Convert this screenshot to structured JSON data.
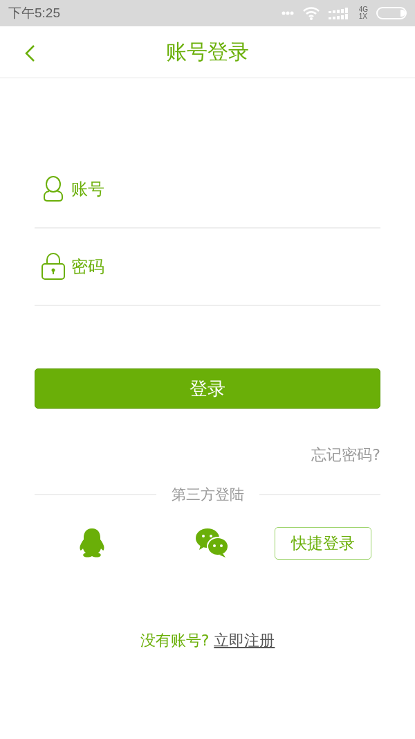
{
  "status_bar": {
    "time": "下午5:25",
    "network": "4G\n1X"
  },
  "header": {
    "title": "账号登录"
  },
  "fields": [
    {
      "kind": "account",
      "placeholder": "账号"
    },
    {
      "kind": "password",
      "placeholder": "密码"
    }
  ],
  "login_button": "登录",
  "forgot_link": "忘记密码?",
  "third_party": {
    "label": "第三方登陆",
    "quick_login_button": "快捷登录"
  },
  "register": {
    "prompt": "没有账号?",
    "link": "立即注册"
  }
}
